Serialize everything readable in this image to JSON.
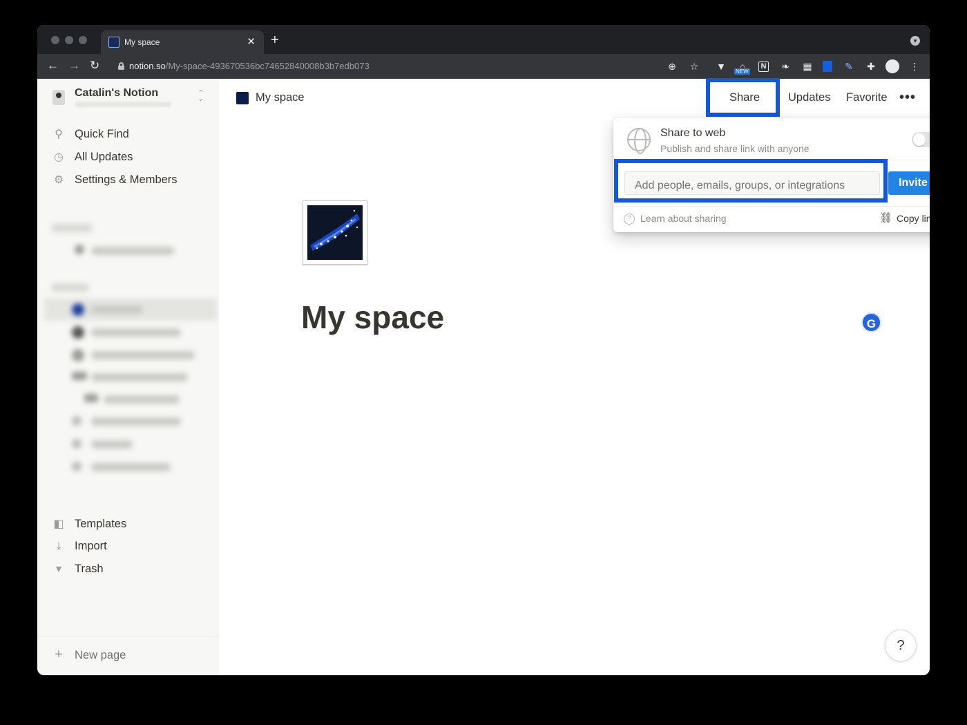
{
  "browser": {
    "tab_title": "My space",
    "tab_close": "✕",
    "new_tab": "+",
    "url_host": "notion.so",
    "url_path": "/My-space-493670536bc74652840008b3b7edb073",
    "extensions": [
      "zoom-icon",
      "bookmark-star-icon",
      "vivaldi-extension-icon",
      "bank-extension-icon",
      "notion-extension-icon",
      "rabbit-extension-icon",
      "grid-extension-icon",
      "bitwarden-extension-icon",
      "pen-extension-icon",
      "puzzle-extensions-icon",
      "profile-avatar-icon",
      "chrome-menu-icon"
    ],
    "extension_badge": "NEW"
  },
  "sidebar": {
    "workspace_name": "Catalin's Notion",
    "top_items": [
      {
        "label": "Quick Find",
        "icon": "search-icon"
      },
      {
        "label": "All Updates",
        "icon": "clock-icon"
      },
      {
        "label": "Settings & Members",
        "icon": "gear-icon"
      }
    ],
    "bottom_items": [
      {
        "label": "Templates",
        "icon": "templates-icon"
      },
      {
        "label": "Import",
        "icon": "download-icon"
      },
      {
        "label": "Trash",
        "icon": "trash-icon"
      }
    ],
    "new_page": "New page"
  },
  "topbar": {
    "page_title": "My space",
    "share": "Share",
    "updates": "Updates",
    "favorite": "Favorite"
  },
  "page": {
    "title": "My space",
    "grammarly": "G",
    "help": "?"
  },
  "share_popover": {
    "title": "Share to web",
    "description": "Publish and share link with anyone",
    "toggle_on": false,
    "invite_placeholder": "Add people, emails, groups, or integrations",
    "invite_button": "Invite",
    "learn_link": "Learn about sharing",
    "copy_link": "Copy link"
  },
  "colors": {
    "highlight": "#1558d6",
    "invite_button": "#2383e2",
    "sidebar_bg": "#f7f7f5",
    "text": "#37352f"
  }
}
